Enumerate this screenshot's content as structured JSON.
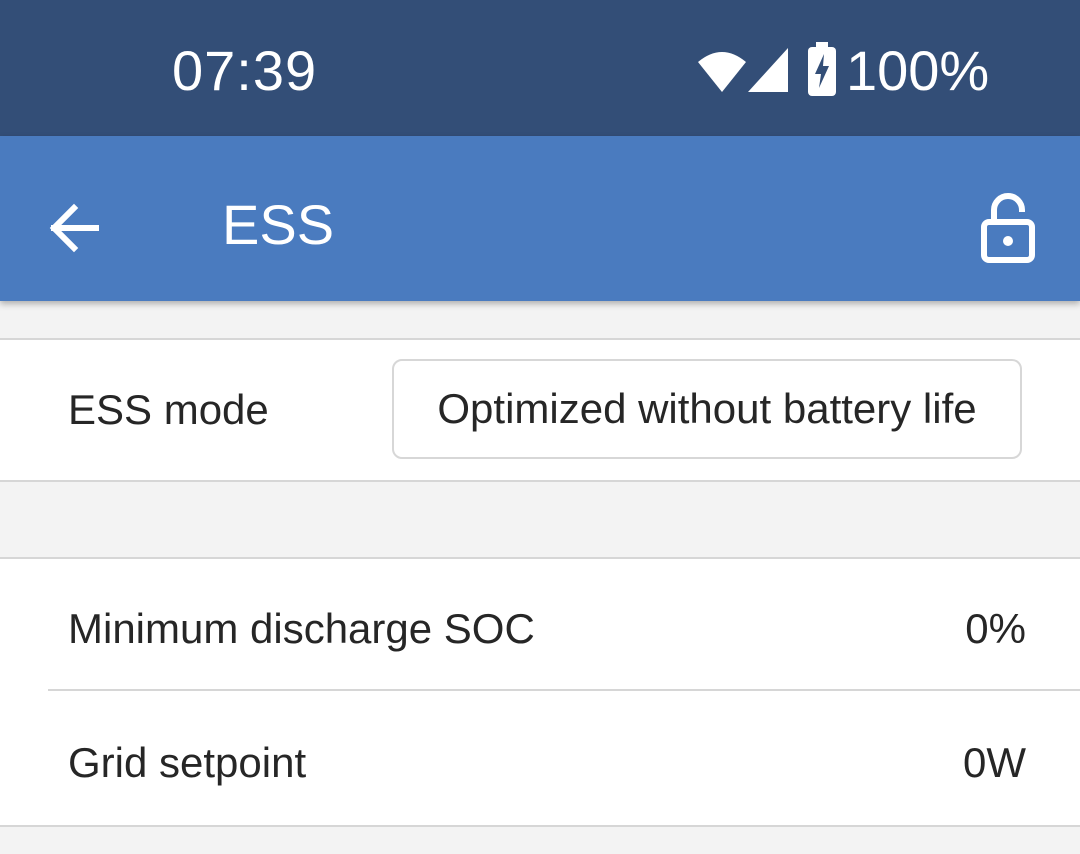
{
  "status_bar": {
    "time": "07:39",
    "battery_percent": "100%",
    "icons": [
      "wifi-icon",
      "cellular-signal-icon",
      "battery-charging-icon"
    ]
  },
  "app_bar": {
    "title": "ESS",
    "back_icon": "arrow-left-icon",
    "lock_icon": "lock-open-icon"
  },
  "ess_mode": {
    "label": "ESS mode",
    "value": "Optimized without battery life"
  },
  "settings": [
    {
      "label": "Minimum discharge SOC",
      "value": "0%"
    },
    {
      "label": "Grid setpoint",
      "value": "0W"
    }
  ],
  "colors": {
    "status_bar": "#334e77",
    "app_bar": "#4a7bbf",
    "background": "#f3f3f3",
    "surface": "#ffffff",
    "divider": "#d6d6d6",
    "text": "#262626"
  }
}
